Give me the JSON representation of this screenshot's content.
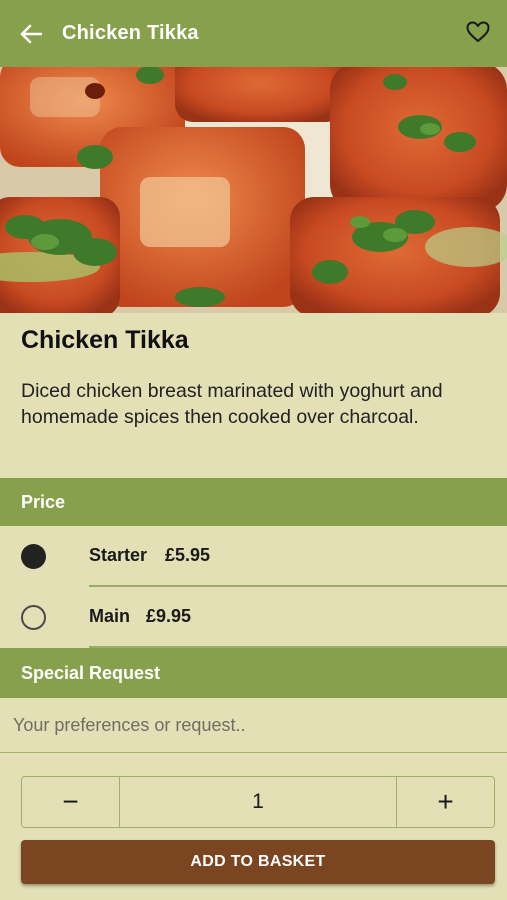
{
  "header": {
    "title": "Chicken Tikka",
    "back_icon": "arrow-left-icon",
    "favorite_icon": "heart-outline-icon"
  },
  "dish": {
    "name": "Chicken Tikka",
    "description": "Diced chicken breast marinated with yoghurt and homemade spices then cooked over charcoal."
  },
  "price_section": {
    "title": "Price",
    "options": [
      {
        "name": "Starter",
        "price": "£5.95",
        "selected": true
      },
      {
        "name": "Main",
        "price": "£9.95",
        "selected": false
      }
    ]
  },
  "special_request": {
    "title": "Special Request",
    "placeholder": "Your preferences or request.."
  },
  "quantity": {
    "minus_label": "−",
    "value": "1",
    "plus_label": "+"
  },
  "add_button": {
    "label": "ADD TO BASKET"
  },
  "colors": {
    "header_green": "#87a04c",
    "background": "#e3e0b6",
    "button_brown": "#7a4520"
  }
}
